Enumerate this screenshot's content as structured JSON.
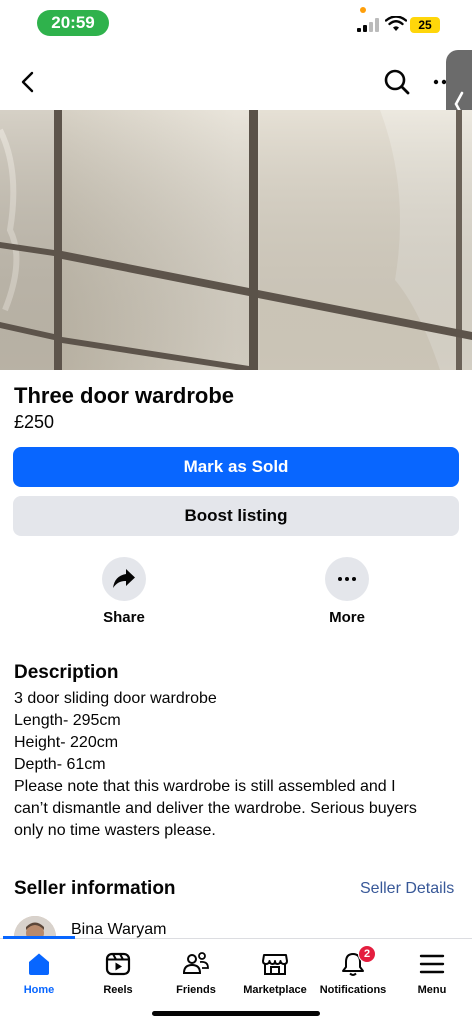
{
  "status_bar": {
    "time": "20:59",
    "battery": "25",
    "icons": [
      "signal-icon",
      "wifi-icon",
      "battery-icon"
    ]
  },
  "header": {
    "icons": [
      "back-arrow-icon",
      "search-icon",
      "more-icon"
    ]
  },
  "listing": {
    "title": "Three door wardrobe",
    "price": "£250",
    "mark_sold_label": "Mark as Sold",
    "boost_label": "Boost listing",
    "share_label": "Share",
    "more_label": "More"
  },
  "description": {
    "heading": "Description",
    "lines": [
      "3 door sliding door wardrobe",
      "Length- 295cm",
      "Height- 220cm",
      "Depth- 61cm",
      "Please note that this wardrobe is still assembled and I",
      "can’t dismantle and deliver the wardrobe. Serious buyers",
      "only no time wasters please."
    ]
  },
  "seller": {
    "heading": "Seller information",
    "details_link": "Seller Details",
    "name": "Bina Waryam"
  },
  "bottom_nav": {
    "items": [
      {
        "label": "Home",
        "icon": "home-icon"
      },
      {
        "label": "Reels",
        "icon": "reels-icon"
      },
      {
        "label": "Friends",
        "icon": "friends-icon"
      },
      {
        "label": "Marketplace",
        "icon": "marketplace-icon"
      },
      {
        "label": "Notifications",
        "icon": "bell-icon",
        "badge": "2"
      },
      {
        "label": "Menu",
        "icon": "menu-icon"
      }
    ]
  },
  "colors": {
    "primary": "#0866ff",
    "secondary_button": "#e4e6eb",
    "badge": "#e41e3f",
    "time_pill": "#2fb24c",
    "link": "#385898"
  }
}
